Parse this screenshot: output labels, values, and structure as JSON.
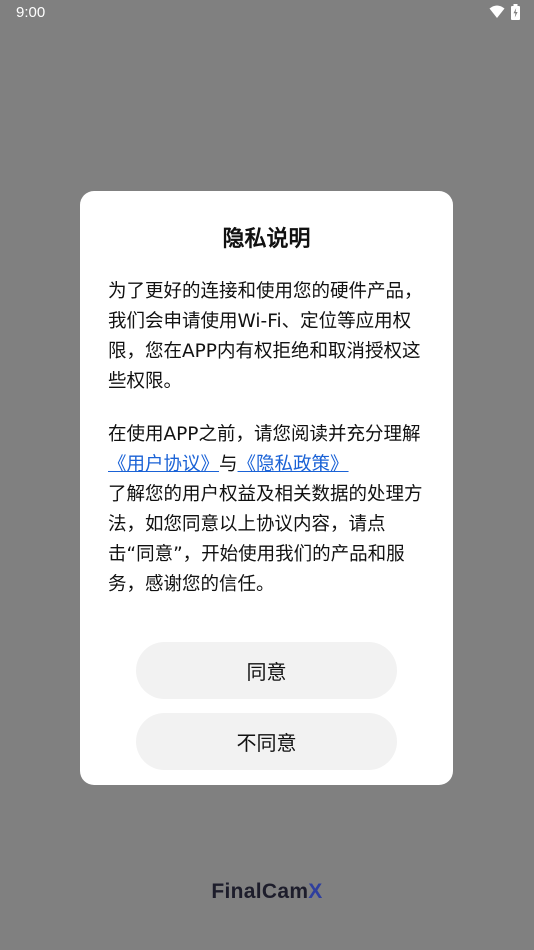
{
  "status_bar": {
    "time": "9:00",
    "icons": [
      "wifi-icon",
      "battery-icon"
    ]
  },
  "dialog": {
    "title": "隐私说明",
    "paragraph1": "为了更好的连接和使用您的硬件产品，我们会申请使用Wi-Fi、定位等应用权限，您在APP内有权拒绝和取消授权这些权限。",
    "paragraph2": {
      "part1": "在使用APP之前，请您阅读并充分理解",
      "link_user_agreement": "《用户协议》",
      "middle": "与",
      "link_privacy_policy": "《隐私政策》",
      "part2": "了解您的用户权益及相关数据的处理方法，如您同意以上协议内容，请点击“同意”，开始使用我们的产品和服务，感谢您的信任。"
    },
    "agree_label": "同意",
    "disagree_label": "不同意"
  },
  "brand": {
    "name_main": "FinalCam",
    "name_accent": "X"
  },
  "colors": {
    "overlay": "#808080",
    "link": "#1a62d6",
    "button_bg": "#f2f2f2",
    "brand_accent": "#2f3f9e"
  }
}
